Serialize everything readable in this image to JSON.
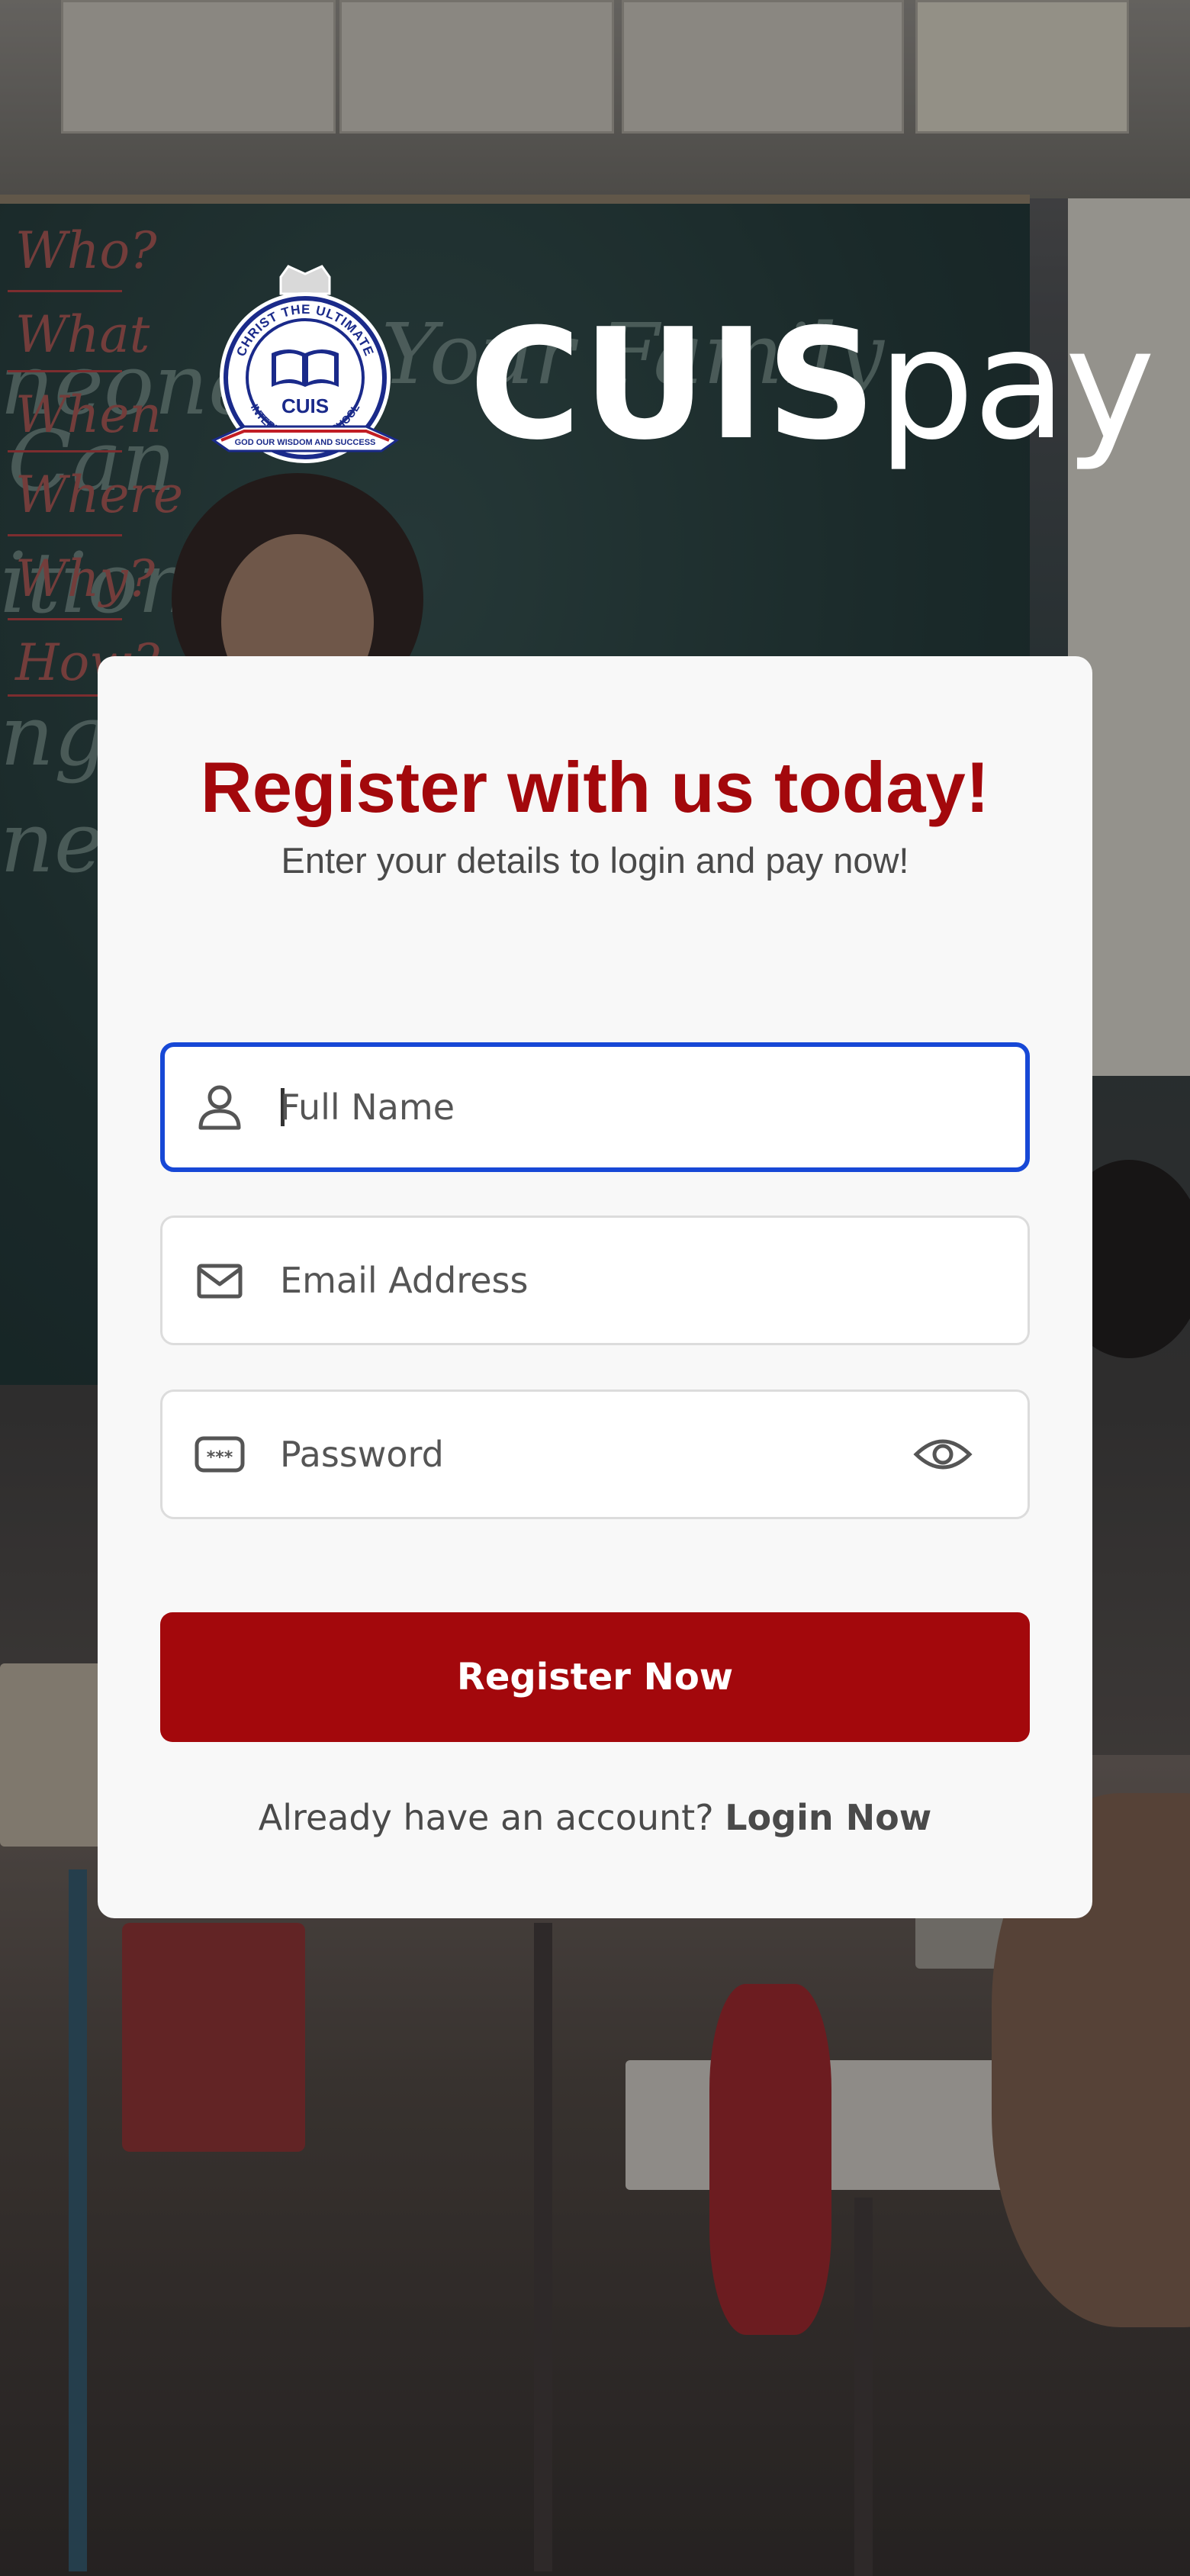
{
  "brand": {
    "crest_text_top": "CHRIST THE ULTIMATE",
    "crest_text_mid": "CUIS",
    "crest_text_bottom": "INTERNATIONAL SCHOOL",
    "crest_motto": "GOD OUR WISDOM AND SUCCESS",
    "wordmark_bold": "CUIS",
    "wordmark_light": "pay"
  },
  "card": {
    "title": "Register with us today!",
    "subtitle": "Enter your details to login and pay now!"
  },
  "form": {
    "full_name": {
      "placeholder": "Full Name",
      "value": "",
      "icon": "user-icon",
      "focused": true
    },
    "email": {
      "placeholder": "Email Address",
      "value": "",
      "icon": "mail-icon"
    },
    "password": {
      "placeholder": "Password",
      "value": "",
      "icon": "password-icon",
      "toggle_icon": "eye-icon"
    },
    "submit_label": "Register Now"
  },
  "footer": {
    "prompt": "Already have an account? ",
    "link_label": "Login Now"
  },
  "colors": {
    "accent": "#a3080c",
    "focus_border": "#1748d6",
    "card_bg": "#f8f8f8"
  }
}
